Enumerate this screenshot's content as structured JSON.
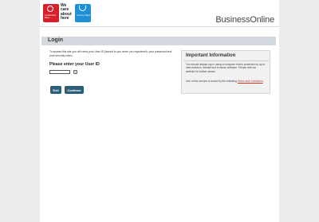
{
  "header": {
    "logo_left_text": "Cumberland Bank",
    "care_lines": [
      "We",
      "care",
      "about",
      "here"
    ],
    "logo_right_text": "Coventry Bank",
    "brand": "BusinessOnline"
  },
  "panel": {
    "title": "Login"
  },
  "login": {
    "intro": "To access this site you will need your User ID (issued to you when you registered), your password and your security token.",
    "prompt": "Please enter your User ID",
    "userid_value": "",
    "help_label": "?",
    "exit_label": "Exit",
    "continue_label": "Continue"
  },
  "info": {
    "title": "Important Information",
    "paragraph1": "You should always log in using a computer that is protected by up to date antivirus, firewall and browser software. Please visit our website for further advice.",
    "paragraph2_prefix": "Use of this service is bound by the following ",
    "terms_link": "Terms and Conditions",
    "paragraph2_suffix": "."
  },
  "colors": {
    "brand_red": "#d6202a",
    "brand_blue": "#1f8fd6",
    "button": "#2e5f78",
    "title_bar": "#d3d9df",
    "link": "#c0392b"
  }
}
